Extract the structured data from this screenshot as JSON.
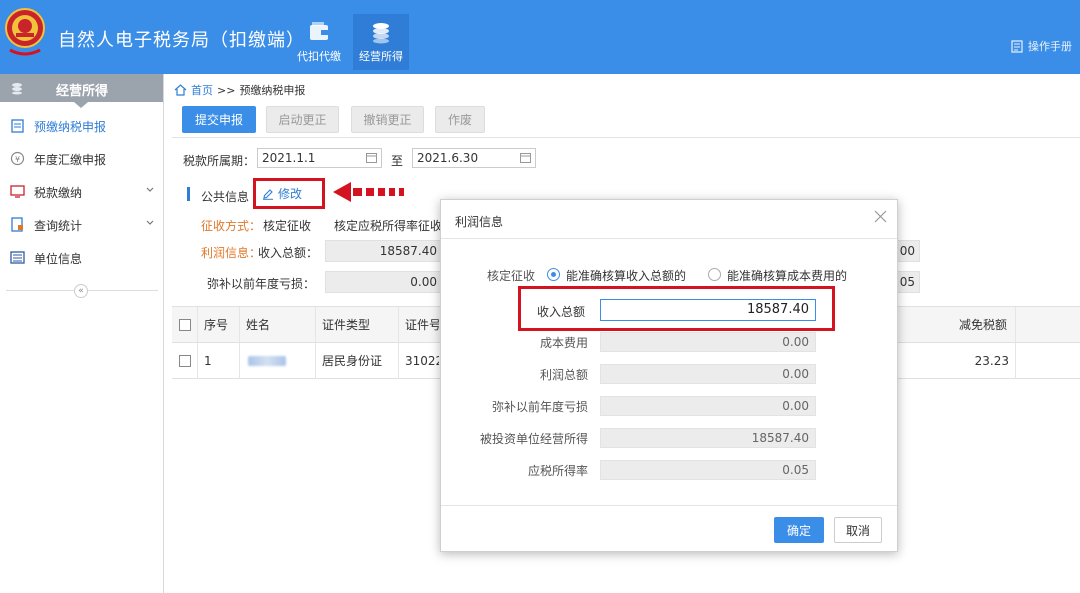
{
  "header": {
    "app_title": "自然人电子税务局（扣缴端）",
    "nav": [
      {
        "label": "代扣代缴",
        "icon": "wallet-icon"
      },
      {
        "label": "经营所得",
        "icon": "coins-icon"
      }
    ],
    "manual_label": "操作手册",
    "colors": {
      "header_bg": "#3b8ee8",
      "accent": "#2f7dd6",
      "alert_red": "#d3131f"
    }
  },
  "sidebar": {
    "title": "经营所得",
    "items": [
      {
        "label": "预缴纳税申报",
        "icon": "clipboard-icon"
      },
      {
        "label": "年度汇缴申报",
        "icon": "yen-icon"
      },
      {
        "label": "税款缴纳",
        "icon": "monitor-icon"
      },
      {
        "label": "查询统计",
        "icon": "report-icon"
      },
      {
        "label": "单位信息",
        "icon": "list-icon"
      }
    ],
    "collapse_label": "«"
  },
  "breadcrumb": {
    "home": "首页",
    "separator": ">>",
    "current": "预缴纳税申报"
  },
  "toolbar": {
    "submit": "提交申报",
    "start_correct": "启动更正",
    "cancel_correct": "撤销更正",
    "void": "作废"
  },
  "period": {
    "label": "税款所属期：",
    "from": "2021.1.1",
    "to_label": "至",
    "to": "2021.6.30"
  },
  "public_info": {
    "label": "公共信息",
    "edit_label": "修改",
    "collection_method_label": "征收方式：",
    "collection_method_value": "核定征收",
    "rate_label": "核定应税所得率征收",
    "profit_label": "利润信息：",
    "income_label": "收入总额：",
    "income_value": "18587.40",
    "loss_label": "弥补以前年度亏损：",
    "loss_value": "0.00",
    "right_value_1": "00",
    "right_value_2": "05"
  },
  "table": {
    "headers": [
      "序号",
      "姓名",
      "证件类型",
      "证件号",
      "减免税额"
    ],
    "rows": [
      {
        "index": "1",
        "name": "",
        "id_type": "居民身份证",
        "id_no": "31022",
        "reduction": "23.23"
      }
    ]
  },
  "dialog": {
    "title": "利润信息",
    "method_label": "核定征收",
    "option_1": "能准确核算收入总额的",
    "option_2": "能准确核算成本费用的",
    "income_label": "收入总额",
    "income_value": "18587.40",
    "cost_label": "成本费用",
    "cost_value": "0.00",
    "profit_label": "利润总额",
    "profit_value": "0.00",
    "loss_label": "弥补以前年度亏损",
    "loss_value": "0.00",
    "invested_label": "被投资单位经营所得",
    "invested_value": "18587.40",
    "rate_label": "应税所得率",
    "rate_value": "0.05",
    "ok_label": "确定",
    "cancel_label": "取消"
  }
}
